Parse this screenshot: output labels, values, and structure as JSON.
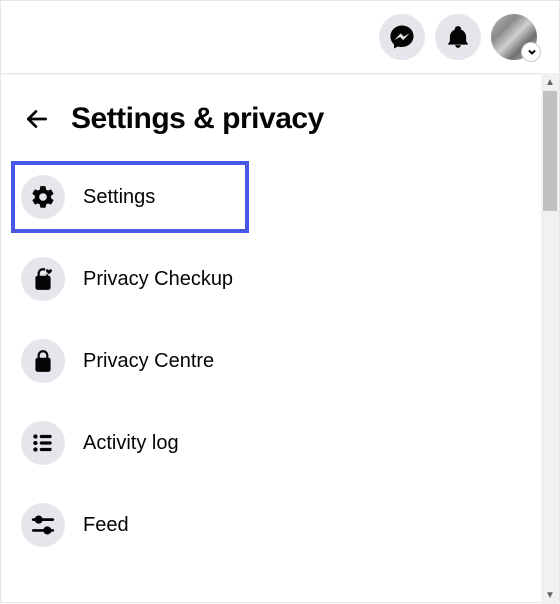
{
  "topbar": {
    "messenger_icon": "messenger-icon",
    "notifications_icon": "bell-icon",
    "avatar": "profile-avatar"
  },
  "panel": {
    "title": "Settings & privacy",
    "items": [
      {
        "label": "Settings",
        "icon": "gear-icon",
        "highlighted": true
      },
      {
        "label": "Privacy Checkup",
        "icon": "lock-heart-icon",
        "highlighted": false
      },
      {
        "label": "Privacy Centre",
        "icon": "lock-icon",
        "highlighted": false
      },
      {
        "label": "Activity log",
        "icon": "activity-log-icon",
        "highlighted": false
      },
      {
        "label": "Feed",
        "icon": "feed-sliders-icon",
        "highlighted": false
      }
    ]
  }
}
